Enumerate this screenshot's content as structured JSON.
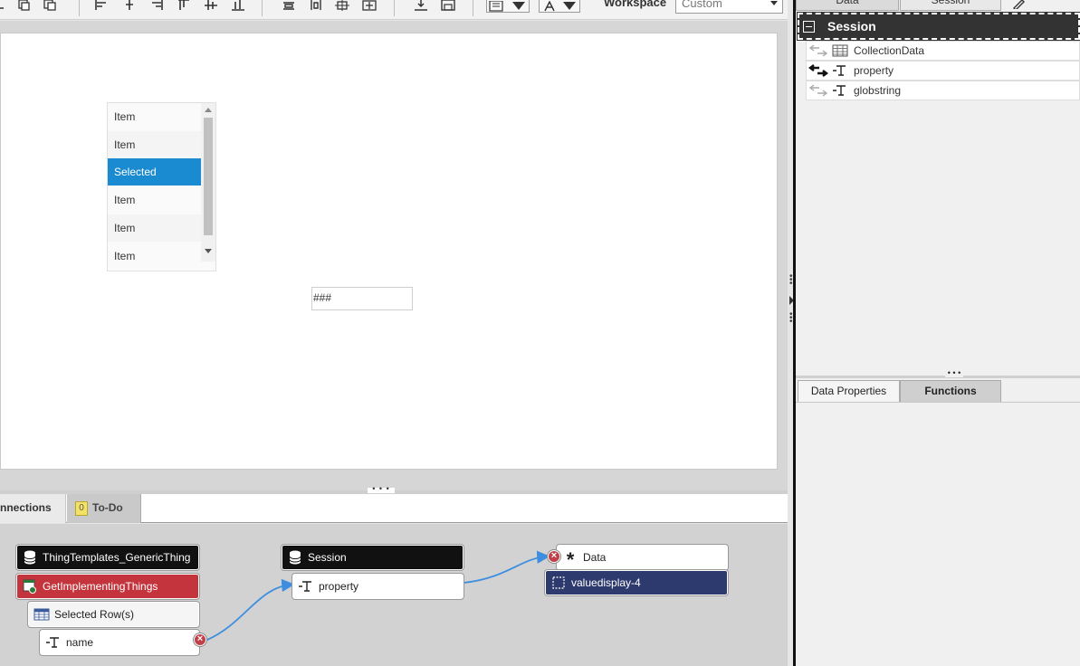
{
  "toolbar": {
    "workspace_label": "Workspace",
    "workspace_value": "Custom"
  },
  "canvas": {
    "list_items": [
      {
        "label": "Item",
        "selected": false
      },
      {
        "label": "Item",
        "selected": false
      },
      {
        "label": "Selected",
        "selected": true
      },
      {
        "label": "Item",
        "selected": false
      },
      {
        "label": "Item",
        "selected": false
      },
      {
        "label": "Item",
        "selected": false
      }
    ],
    "value_display": "###"
  },
  "bottom_tabs": {
    "connections": "nnections",
    "todo": "To-Do",
    "todo_count": "0"
  },
  "connections": {
    "source_thing": "ThingTemplates_GenericThing",
    "service": "GetImplementingThings",
    "selected_rows": "Selected Row(s)",
    "field": "name",
    "session": "Session",
    "session_property": "property",
    "target_data": "Data",
    "target_widget": "valuedisplay-4"
  },
  "right_panel": {
    "tabs": {
      "data": "Data",
      "session": "Session"
    },
    "session_header": "Session",
    "items": [
      {
        "label": "CollectionData",
        "icon": "table-icon",
        "bound": false
      },
      {
        "label": "property",
        "icon": "text-type-icon",
        "bound": true
      },
      {
        "label": "globstring",
        "icon": "text-type-icon",
        "bound": false
      }
    ],
    "bottom_tabs": {
      "data_properties": "Data Properties",
      "functions": "Functions"
    }
  },
  "colors": {
    "selected_item": "#1b8bd1",
    "service_node": "#c4343c",
    "widget_node": "#2d3a6e",
    "link_curve": "#3d8ee0",
    "remove_button": "#c0404a"
  }
}
